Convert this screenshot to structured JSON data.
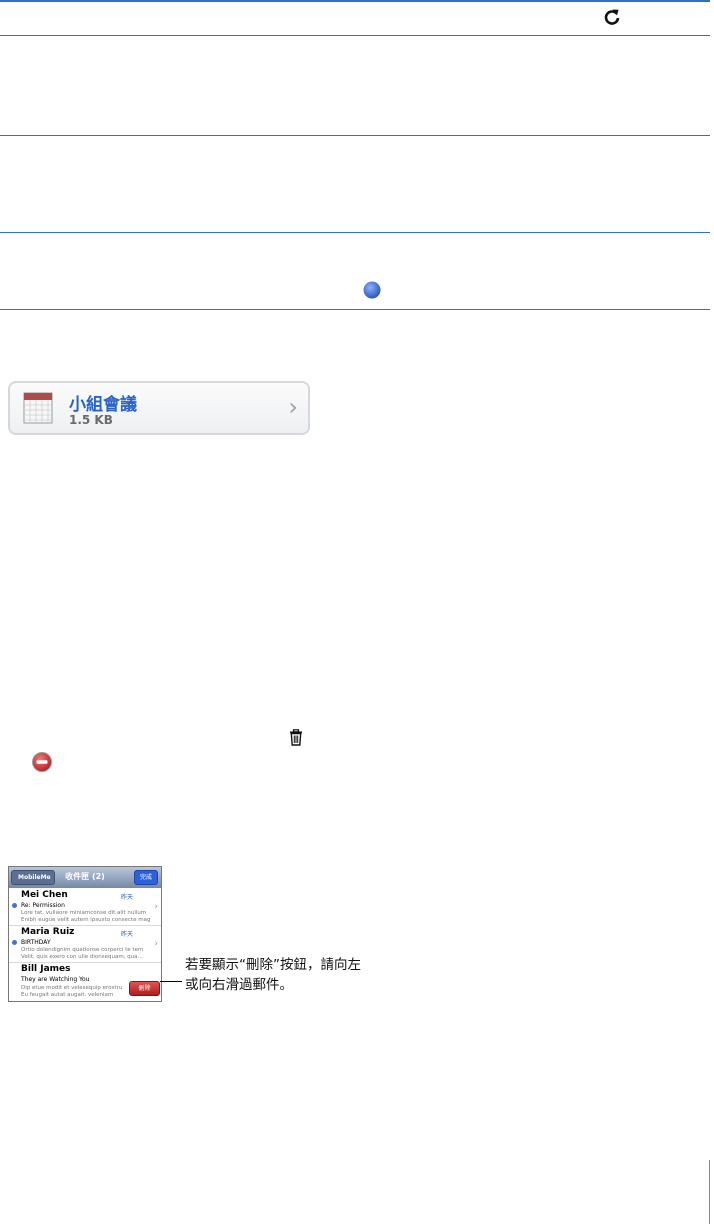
{
  "icons": {
    "refresh": "refresh-icon",
    "unread_dot": "unread-dot-icon",
    "calendar": "calendar-icon",
    "trash": "trash-icon",
    "delete_minus": "delete-minus-icon"
  },
  "colors": {
    "accent": "#2f6fc4",
    "link_blue": "#2a63c8",
    "delete_red": "#c62828"
  },
  "attachment": {
    "title": "小組會議",
    "size": "1.5 KB"
  },
  "phone": {
    "back_label": "MobileMe",
    "title": "收件匣 (2)",
    "done_label": "完成",
    "messages": [
      {
        "sender": "Mei Chen",
        "time": "昨天",
        "subject": "Re: Permission",
        "preview1": "Lore tat, vullaore miniamconse dit alit nullum",
        "preview2": "Enibh eugue velit autem ipsusto consecte mag"
      },
      {
        "sender": "Maria Ruiz",
        "time": "昨天",
        "subject": "BIRTHDAY",
        "preview1": "Ortio dolendignim quationse corperci te tem",
        "preview2": "Velit, quis exero con ulle dionsequam, qua..."
      },
      {
        "sender": "Bill James",
        "subject": "They are Watching You",
        "preview1": "Dip etue modit et velesequip erostru",
        "preview2": "Eu feugait autat augait. veleniam",
        "delete_label": "刪除"
      }
    ]
  },
  "callout": {
    "line1": "若要顯示“刪除”按鈕，請向左",
    "line2": "或向右滑過郵件。"
  }
}
